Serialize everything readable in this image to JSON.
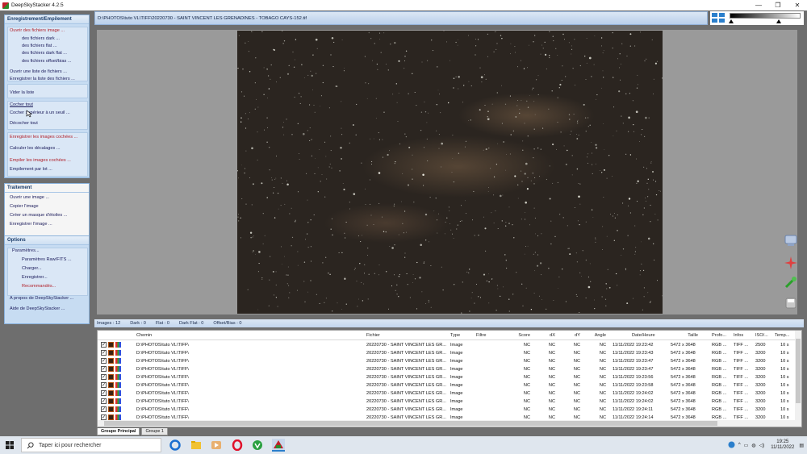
{
  "window": {
    "title": "DeepSkyStacker 4.2.5",
    "minimize": "—",
    "maximize": "❐",
    "close": "✕"
  },
  "sidebar": {
    "group1": {
      "title": "Enregistrement/Empilement",
      "items": [
        {
          "label": "Ouvrir des fichiers image ...",
          "style": "red"
        },
        {
          "label": "des fichiers dark ..."
        },
        {
          "label": "des fichiers flat ..."
        },
        {
          "label": "des fichiers dark flat ..."
        },
        {
          "label": "des fichiers offset/bias ..."
        },
        {
          "label": "Ouvrir une liste de fichiers ..."
        },
        {
          "label": "Enregistrer la liste des fichiers ..."
        },
        {
          "label": "Vider la liste"
        },
        {
          "label": "Cocher tout"
        },
        {
          "label": "Cocher supérieur à un seuil ..."
        },
        {
          "label": "Décocher tout"
        },
        {
          "label": "Enregistrer les images cochées ...",
          "style": "red"
        },
        {
          "label": "Calculer les décalages ..."
        },
        {
          "label": "Empiler les images cochées ...",
          "style": "red"
        },
        {
          "label": "Empilement par lot ..."
        }
      ]
    },
    "group2": {
      "title": "Traitement",
      "items": [
        {
          "label": "Ouvrir une image ..."
        },
        {
          "label": "Copier l'image"
        },
        {
          "label": "Créer un masque d'étoiles ..."
        },
        {
          "label": "Enregistrer l'image ..."
        }
      ]
    },
    "group3": {
      "title": "Options",
      "items": [
        {
          "label": "Paramètres..."
        },
        {
          "label": "Paramètres Raw/FITS ..."
        },
        {
          "label": "Charger..."
        },
        {
          "label": "Enregistrer..."
        },
        {
          "label": "Recommandés...",
          "style": "red"
        },
        {
          "label": "A propos de DeepSkyStacker ..."
        },
        {
          "label": "Aide de DeepSkyStacker ..."
        }
      ]
    }
  },
  "pathbar": {
    "path": "D:\\PHOTOS\\tuto VL\\TIFF\\20220730 - SAINT VINCENT LES GRENADINES - TOBAGO CAYS-152.tif"
  },
  "status": {
    "images": "Images : 12",
    "dark": "Dark : 0",
    "flat": "Flat : 0",
    "darkflat": "Dark Flat : 0",
    "offset": "Offset/Bias : 0"
  },
  "table": {
    "headers": {
      "chemin": "Chemin",
      "fichier": "Fichier",
      "type": "Type",
      "filtre": "Filtre",
      "score": "Score",
      "dx": "dX",
      "dy": "dY",
      "angle": "Angle",
      "date": "Date/Heure",
      "taille": "Taille",
      "profondeur": "Profo...",
      "infos": "Infos",
      "iso": "ISO/...",
      "temps": "Temp..."
    },
    "rows": [
      {
        "chemin": "D:\\PHOTOS\\tuto VL\\TIFF\\",
        "fichier": "20220730 - SAINT VINCENT LES GR...",
        "type": "Image",
        "score": "NC",
        "dx": "NC",
        "dy": "NC",
        "angle": "NC",
        "date": "11/11/2022 19:23:42",
        "taille": "5472 x 3648",
        "prof": "RGB ...",
        "infos": "TIFF ...",
        "iso": "2500",
        "temps": "10 s"
      },
      {
        "chemin": "D:\\PHOTOS\\tuto VL\\TIFF\\",
        "fichier": "20220730 - SAINT VINCENT LES GR...",
        "type": "Image",
        "score": "NC",
        "dx": "NC",
        "dy": "NC",
        "angle": "NC",
        "date": "11/11/2022 19:23:43",
        "taille": "5472 x 3648",
        "prof": "RGB ...",
        "infos": "TIFF ...",
        "iso": "3200",
        "temps": "10 s"
      },
      {
        "chemin": "D:\\PHOTOS\\tuto VL\\TIFF\\",
        "fichier": "20220730 - SAINT VINCENT LES GR...",
        "type": "Image",
        "score": "NC",
        "dx": "NC",
        "dy": "NC",
        "angle": "NC",
        "date": "11/11/2022 19:23:47",
        "taille": "5472 x 3648",
        "prof": "RGB ...",
        "infos": "TIFF ...",
        "iso": "3200",
        "temps": "10 s"
      },
      {
        "chemin": "D:\\PHOTOS\\tuto VL\\TIFF\\",
        "fichier": "20220730 - SAINT VINCENT LES GR...",
        "type": "Image",
        "score": "NC",
        "dx": "NC",
        "dy": "NC",
        "angle": "NC",
        "date": "11/11/2022 19:23:47",
        "taille": "5472 x 3648",
        "prof": "RGB ...",
        "infos": "TIFF ...",
        "iso": "3200",
        "temps": "10 s"
      },
      {
        "chemin": "D:\\PHOTOS\\tuto VL\\TIFF\\",
        "fichier": "20220730 - SAINT VINCENT LES GR...",
        "type": "Image",
        "score": "NC",
        "dx": "NC",
        "dy": "NC",
        "angle": "NC",
        "date": "11/11/2022 19:23:56",
        "taille": "5472 x 3648",
        "prof": "RGB ...",
        "infos": "TIFF ...",
        "iso": "3200",
        "temps": "10 s"
      },
      {
        "chemin": "D:\\PHOTOS\\tuto VL\\TIFF\\",
        "fichier": "20220730 - SAINT VINCENT LES GR...",
        "type": "Image",
        "score": "NC",
        "dx": "NC",
        "dy": "NC",
        "angle": "NC",
        "date": "11/11/2022 19:23:58",
        "taille": "5472 x 3648",
        "prof": "RGB ...",
        "infos": "TIFF ...",
        "iso": "3200",
        "temps": "10 s"
      },
      {
        "chemin": "D:\\PHOTOS\\tuto VL\\TIFF\\",
        "fichier": "20220730 - SAINT VINCENT LES GR...",
        "type": "Image",
        "score": "NC",
        "dx": "NC",
        "dy": "NC",
        "angle": "NC",
        "date": "11/11/2022 19:24:02",
        "taille": "5472 x 3648",
        "prof": "RGB ...",
        "infos": "TIFF ...",
        "iso": "3200",
        "temps": "10 s"
      },
      {
        "chemin": "D:\\PHOTOS\\tuto VL\\TIFF\\",
        "fichier": "20220730 - SAINT VINCENT LES GR...",
        "type": "Image",
        "score": "NC",
        "dx": "NC",
        "dy": "NC",
        "angle": "NC",
        "date": "11/11/2022 19:24:02",
        "taille": "5472 x 3648",
        "prof": "RGB ...",
        "infos": "TIFF ...",
        "iso": "3200",
        "temps": "10 s"
      },
      {
        "chemin": "D:\\PHOTOS\\tuto VL\\TIFF\\",
        "fichier": "20220730 - SAINT VINCENT LES GR...",
        "type": "Image",
        "score": "NC",
        "dx": "NC",
        "dy": "NC",
        "angle": "NC",
        "date": "11/11/2022 19:24:11",
        "taille": "5472 x 3648",
        "prof": "RGB ...",
        "infos": "TIFF ...",
        "iso": "3200",
        "temps": "10 s"
      },
      {
        "chemin": "D:\\PHOTOS\\tuto VL\\TIFF\\",
        "fichier": "20220730 - SAINT VINCENT LES GR...",
        "type": "Image",
        "score": "NC",
        "dx": "NC",
        "dy": "NC",
        "angle": "NC",
        "date": "11/11/2022 19:24:14",
        "taille": "5472 x 3648",
        "prof": "RGB ...",
        "infos": "TIFF ...",
        "iso": "3200",
        "temps": "10 s"
      }
    ]
  },
  "tabs": [
    "Groupe Principal",
    "Groupe 1"
  ],
  "taskbar": {
    "search_placeholder": "Taper ici pour rechercher",
    "time": "19:25",
    "date": "11/11/2022"
  },
  "colors": {
    "accent": "#2b7fcc",
    "panel": "#c7dcf2",
    "red_item": "#b0202a"
  }
}
